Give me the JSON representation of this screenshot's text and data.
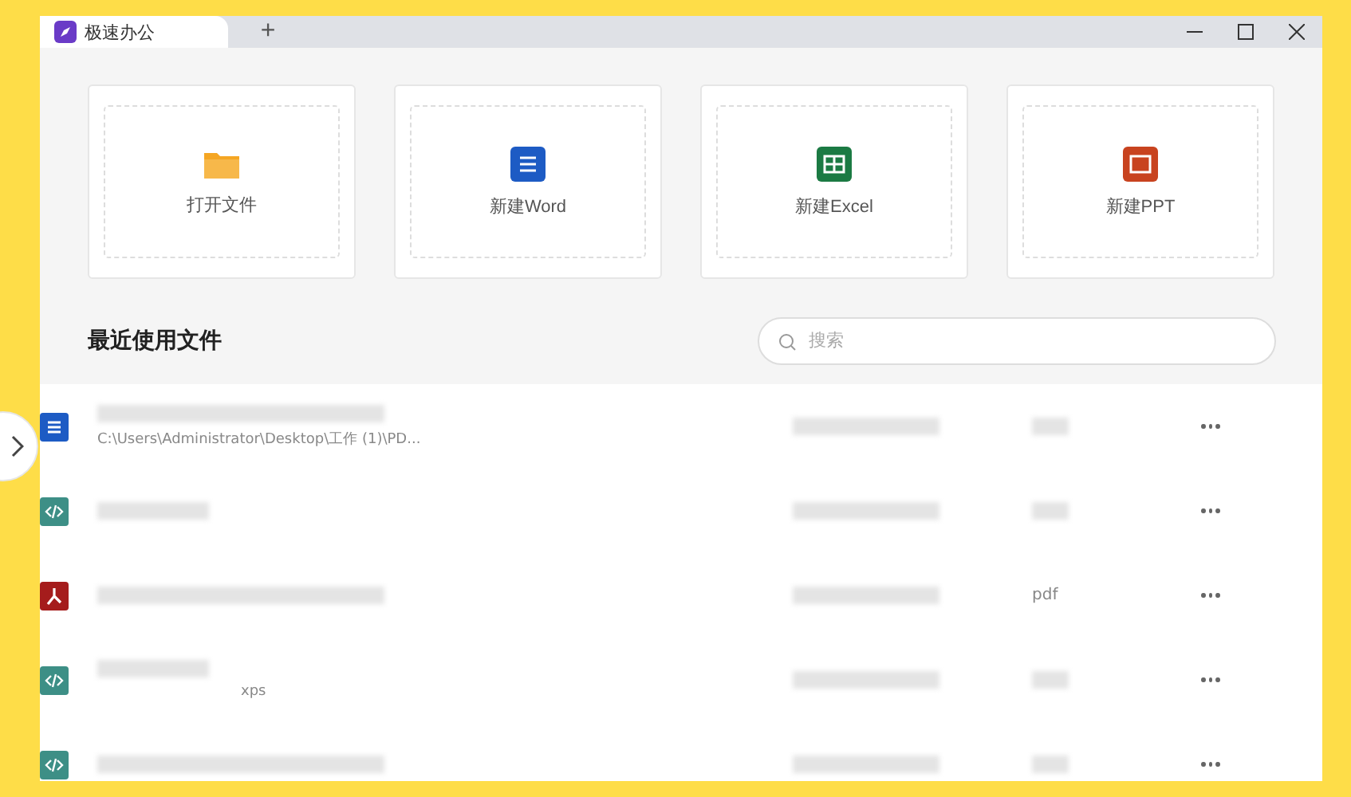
{
  "window": {
    "tab_title": "极速办公",
    "new_tab": "+"
  },
  "actions": [
    {
      "kind": "folder",
      "label": "打开文件"
    },
    {
      "kind": "word",
      "label": "新建Word"
    },
    {
      "kind": "excel",
      "label": "新建Excel"
    },
    {
      "kind": "ppt",
      "label": "新建PPT"
    }
  ],
  "recent": {
    "title": "最近使用文件",
    "search": {
      "placeholder": "搜索"
    }
  },
  "rows": [
    {
      "kind": "word",
      "path": "C:\\Users\\Administrator\\Desktop\\工作 (1)\\PD..."
    },
    {
      "kind": "code"
    },
    {
      "kind": "pdf",
      "type": "pdf"
    },
    {
      "kind": "code",
      "path_tail": "xps"
    },
    {
      "kind": "code"
    }
  ]
}
